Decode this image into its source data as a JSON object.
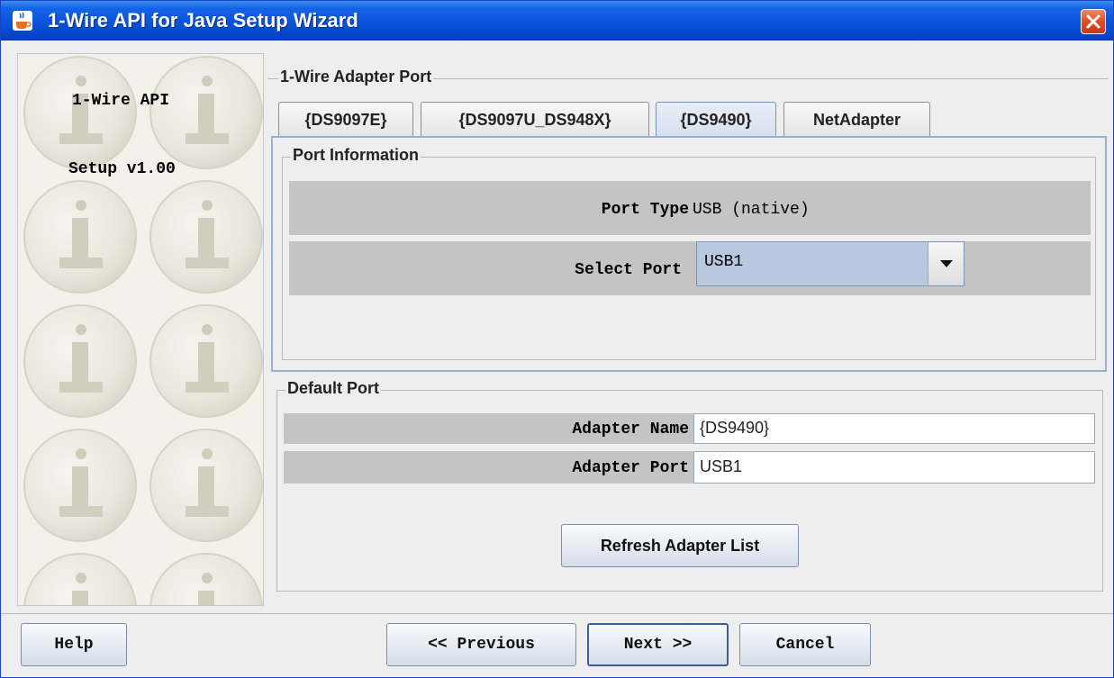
{
  "window": {
    "title": "1-Wire API for Java Setup Wizard"
  },
  "left_panel": {
    "api_label": "1-Wire API",
    "setup_label": "Setup v1.00"
  },
  "adapter_port": {
    "group_title": "1-Wire Adapter Port",
    "tabs": [
      {
        "label": "{DS9097E}"
      },
      {
        "label": "{DS9097U_DS948X}"
      },
      {
        "label": "{DS9490}",
        "selected": true
      },
      {
        "label": "NetAdapter"
      }
    ],
    "port_information": {
      "title": "Port Information",
      "port_type_label": "Port Type",
      "port_type_value": "USB (native)",
      "select_port_label": "Select Port",
      "select_port_value": "USB1"
    }
  },
  "default_port": {
    "title": "Default Port",
    "adapter_name_label": "Adapter Name",
    "adapter_name_value": "{DS9490}",
    "adapter_port_label": "Adapter Port",
    "adapter_port_value": "USB1",
    "refresh_button": "Refresh Adapter List"
  },
  "footer": {
    "help": "Help",
    "previous": "<< Previous",
    "next": "Next >>",
    "cancel": "Cancel"
  },
  "colors": {
    "titlebar": "#0a55de",
    "close": "#e0502c",
    "row_bar": "#c4c4c4",
    "selected_tab_border": "#9ab0d3"
  },
  "icons": {
    "app": "java-cup-icon",
    "close": "close-icon",
    "dropdown": "triangle-down-icon",
    "decoration": "info-coin-icon"
  }
}
